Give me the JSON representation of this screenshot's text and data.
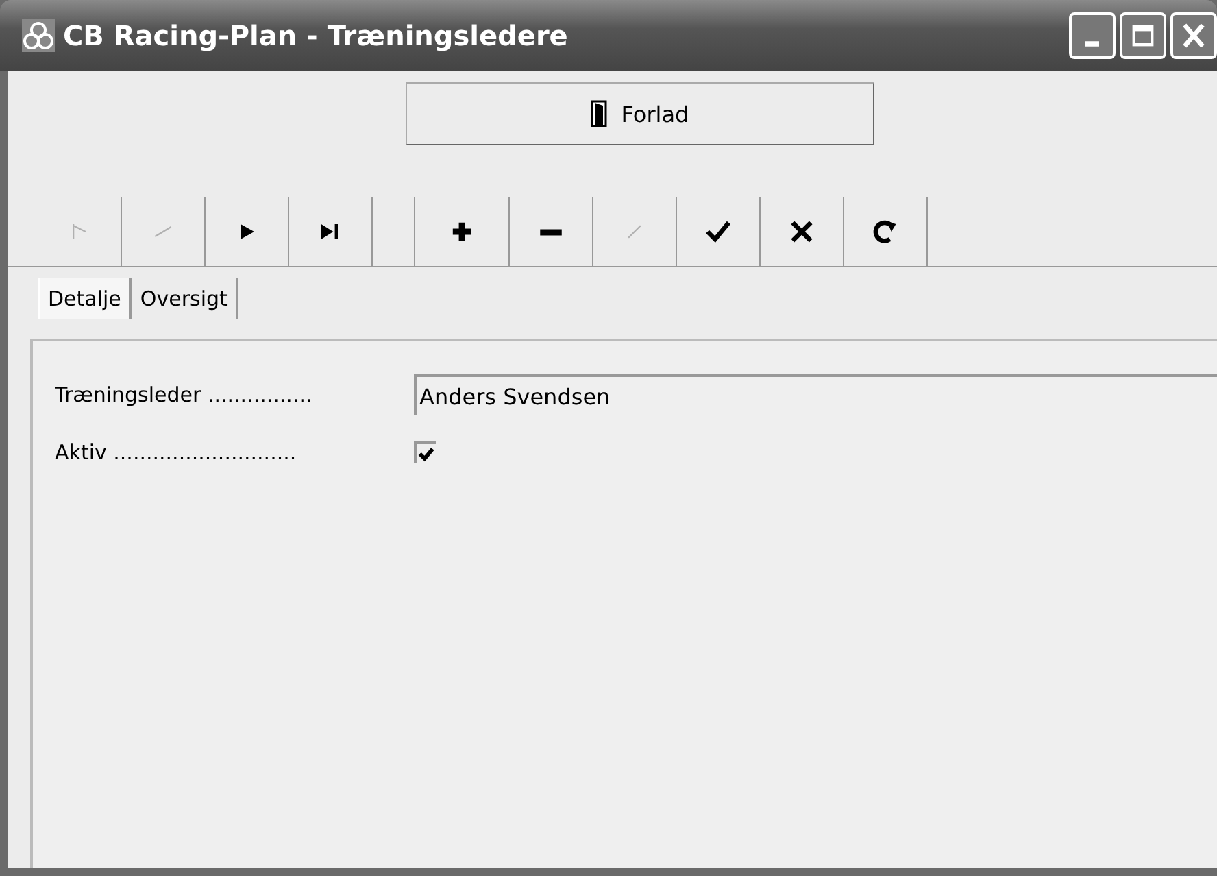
{
  "window": {
    "title": "CB Racing-Plan - Træningsledere"
  },
  "exit_button": {
    "label": "Forlad"
  },
  "toolbar": [
    {
      "kind": "first",
      "disabled": true
    },
    {
      "kind": "prev",
      "disabled": true
    },
    {
      "kind": "next",
      "disabled": false
    },
    {
      "kind": "last",
      "disabled": false
    },
    {
      "kind": "add",
      "disabled": false,
      "gap": true
    },
    {
      "kind": "delete",
      "disabled": false
    },
    {
      "kind": "edit",
      "disabled": true
    },
    {
      "kind": "save",
      "disabled": false
    },
    {
      "kind": "cancel",
      "disabled": false
    },
    {
      "kind": "refresh",
      "disabled": false
    }
  ],
  "tabs": [
    {
      "label": "Detalje",
      "selected": true
    },
    {
      "label": "Oversigt",
      "selected": false
    }
  ],
  "fields": [
    {
      "label": "Træningsleder ................",
      "kind": "text",
      "value": "Anders Svendsen"
    },
    {
      "label": "Aktiv ............................",
      "kind": "checkbox",
      "checked": true
    }
  ]
}
